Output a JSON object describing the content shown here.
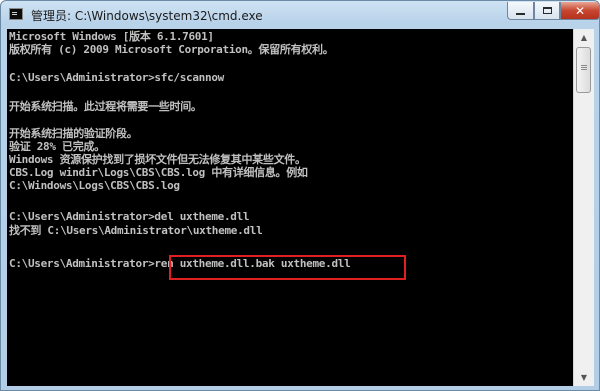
{
  "window": {
    "title": "管理员: C:\\Windows\\system32\\cmd.exe",
    "controls": {
      "minimize": "minimize-icon",
      "maximize": "maximize-icon",
      "close": "✕"
    }
  },
  "console": {
    "lines": [
      "Microsoft Windows [版本 6.1.7601]",
      "版权所有 (c) 2009 Microsoft Corporation。保留所有权利。",
      "",
      "C:\\Users\\Administrator>sfc/scannow",
      "",
      "开始系统扫描。此过程将需要一些时间。",
      "",
      "开始系统扫描的验证阶段。",
      "验证 28% 已完成。",
      "Windows 资源保护找到了损坏文件但无法修复其中某些文件。",
      "CBS.Log windir\\Logs\\CBS\\CBS.log 中有详细信息。例如",
      "C:\\Windows\\Logs\\CBS\\CBS.log",
      "",
      "C:\\Users\\Administrator>del uxtheme.dll",
      "找不到 C:\\Users\\Administrator\\uxtheme.dll",
      "",
      "C:\\Users\\Administrator>ren uxtheme.dll.bak uxtheme.dll"
    ]
  },
  "scrollbar": {
    "up_icon": "▲",
    "down_icon": "▼"
  },
  "colors": {
    "console_bg": "#000000",
    "console_text": "#c0c0c0",
    "highlight_border": "#e02020"
  }
}
